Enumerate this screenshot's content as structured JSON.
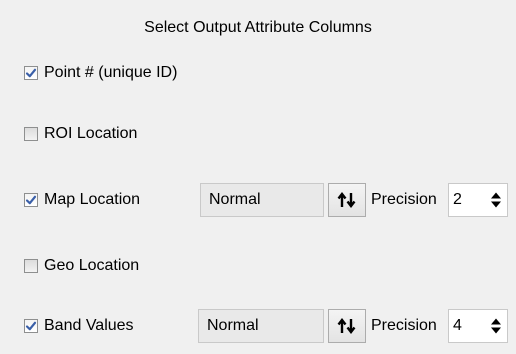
{
  "panel": {
    "title": "Select Output Attribute Columns"
  },
  "rows": {
    "point_id": {
      "label": "Point # (unique ID)",
      "checked": true
    },
    "roi_location": {
      "label": "ROI Location",
      "checked": false
    },
    "map_location": {
      "label": "Map Location",
      "checked": true,
      "mode": "Normal",
      "precision_label": "Precision",
      "precision_value": "2"
    },
    "geo_location": {
      "label": "Geo Location",
      "checked": false
    },
    "band_values": {
      "label": "Band Values",
      "checked": true,
      "mode": "Normal",
      "precision_label": "Precision",
      "precision_value": "4"
    }
  },
  "icons": {
    "checkmark": "checkmark-icon",
    "swap": "up-down-arrows-icon",
    "spinner": "spinner-arrows-icon"
  },
  "colors": {
    "background": "#f0f0f0",
    "checkmark": "#3a5fa8",
    "field_background": "#e9e9e9"
  }
}
